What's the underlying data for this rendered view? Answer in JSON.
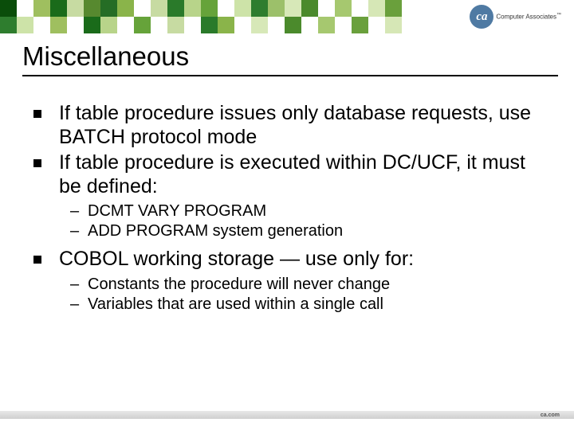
{
  "brand": {
    "badge": "ca",
    "name": "Computer Associates",
    "tm": "™"
  },
  "title": "Miscellaneous",
  "bullets": [
    {
      "text": "If table procedure issues only database requests, use BATCH protocol mode",
      "sub": []
    },
    {
      "text": "If table procedure is executed within DC/UCF, it must be defined:",
      "sub": [
        "DCMT VARY PROGRAM",
        "ADD PROGRAM system generation"
      ]
    },
    {
      "text": "COBOL working storage — use only for:",
      "sub": [
        "Constants the procedure will never change",
        "Variables that are used within a single call"
      ]
    }
  ],
  "footer": "ca.com",
  "tile_colors_row1": [
    "#0a4d0a",
    "#ffffff",
    "#9fbf5f",
    "#1a6b1a",
    "#c7dba2",
    "#57892f",
    "#256d25",
    "#8ab44a",
    "#ffffff",
    "#c7dba2",
    "#2a7a2a",
    "#b8d48a",
    "#66a33a",
    "#ffffff",
    "#cde3a8",
    "#2e7d2e",
    "#9cc06a",
    "#d7e8b8",
    "#4b8a2c",
    "#ffffff",
    "#a6c86f",
    "#ffffff",
    "#d6e7b6",
    "#6aa03c",
    "#ffffff",
    "#ffffff",
    "#ffffff"
  ],
  "tile_colors_row2": [
    "#2e7d2e",
    "#cde3a8",
    "#ffffff",
    "#9fbf5f",
    "#ffffff",
    "#1a6b1a",
    "#b8d48a",
    "#ffffff",
    "#66a33a",
    "#ffffff",
    "#c7dba2",
    "#ffffff",
    "#2a7a2a",
    "#8ab44a",
    "#ffffff",
    "#d7e8b8",
    "#ffffff",
    "#4b8a2c",
    "#ffffff",
    "#a6c86f",
    "#ffffff",
    "#6aa03c",
    "#ffffff",
    "#d6e7b6",
    "#ffffff",
    "#ffffff",
    "#ffffff"
  ]
}
